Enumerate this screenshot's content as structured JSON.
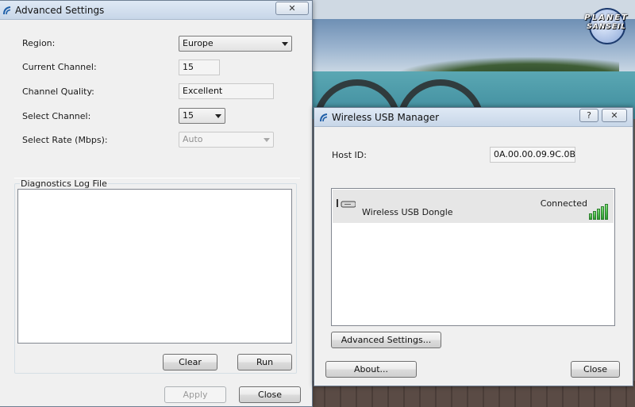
{
  "advanced_settings": {
    "title": "Advanced Settings",
    "close_glyph": "✕",
    "region": {
      "label": "Region:",
      "value": "Europe"
    },
    "current_channel": {
      "label": "Current Channel:",
      "value": "15"
    },
    "channel_quality": {
      "label": "Channel Quality:",
      "value": "Excellent"
    },
    "select_channel": {
      "label": "Select Channel:",
      "value": "15"
    },
    "select_rate": {
      "label": "Select Rate (Mbps):",
      "value": "Auto"
    },
    "log_group": {
      "title": "Diagnostics Log File"
    },
    "buttons": {
      "clear": "Clear",
      "run": "Run",
      "apply": "Apply",
      "close": "Close"
    }
  },
  "wireless_manager": {
    "title": "Wireless USB Manager",
    "help_glyph": "?",
    "close_glyph": "✕",
    "host_id": {
      "label": "Host ID:",
      "value": "0A.00.00.09.9C.0B"
    },
    "devices": [
      {
        "name": "Wireless USB Dongle",
        "status": "Connected",
        "signal_bars": 5
      }
    ],
    "buttons": {
      "advanced": "Advanced Settings...",
      "about": "About...",
      "close": "Close"
    }
  },
  "logo": {
    "line1": "PLANET",
    "line2": "SANSEIL"
  },
  "colors": {
    "signal_green": "#3bb23d",
    "title_bar": "#c7d6e8",
    "window_bg": "#f0f0f0"
  }
}
